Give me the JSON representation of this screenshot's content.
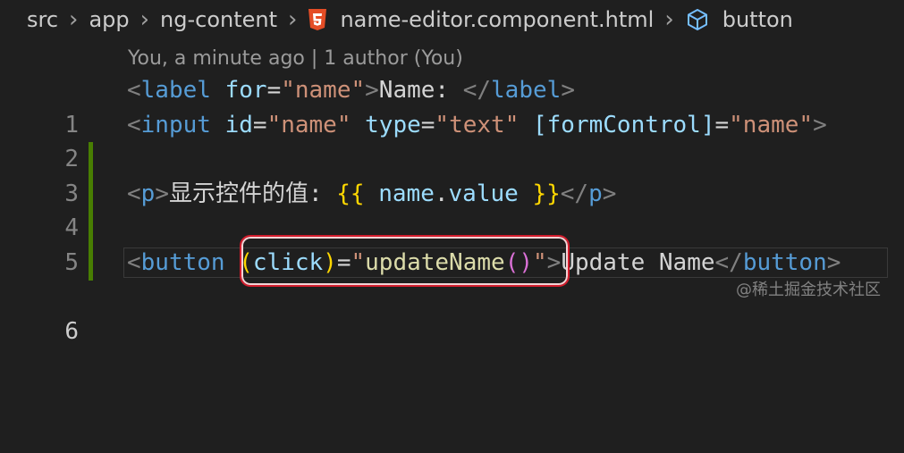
{
  "breadcrumb": {
    "items": [
      "src",
      "app",
      "ng-content",
      "name-editor.component.html",
      "button"
    ]
  },
  "blame": {
    "text": "You, a minute ago | 1 author (You)"
  },
  "lines": [
    {
      "number": "1"
    },
    {
      "number": "2"
    },
    {
      "number": "3"
    },
    {
      "number": "4"
    },
    {
      "number": "5"
    },
    {
      "number": "6"
    }
  ],
  "code": {
    "l1": {
      "lt": "<",
      "tag": "label",
      "attr": "for",
      "eq": "=",
      "val": "\"name\"",
      "gt": ">",
      "text": "Name: ",
      "close_lt": "</",
      "close_tag": "label",
      "close_gt": ">"
    },
    "l2": {
      "lt": "<",
      "tag": "input",
      "attr1": "id",
      "eq1": "=",
      "val1": "\"name\"",
      "attr2": "type",
      "eq2": "=",
      "val2": "\"text\"",
      "attr3": "[formControl]",
      "eq3": "=",
      "val3": "\"name\"",
      "gt": ">"
    },
    "l4": {
      "lt": "<",
      "tag": "p",
      "gt": ">",
      "text": "显示控件的值: ",
      "open": "{{",
      "expr_obj": "name",
      "expr_dot": ".",
      "expr_prop": "value",
      "close": "}}",
      "close_lt": "</",
      "close_tag": "p",
      "close_gt": ">"
    },
    "l6": {
      "lt": "<",
      "tag": "button",
      "attr_open": "(",
      "attr": "click",
      "attr_close": ")",
      "eq": "=",
      "q1": "\"",
      "func": "updateName",
      "paren": "()",
      "q2": "\"",
      "gt": ">",
      "text": "Update Name",
      "close_lt": "</",
      "close_tag": "button",
      "close_gt": ">"
    }
  },
  "colors": {
    "background": "#1f1f1f",
    "gutter_modified": "#487e02",
    "highlight_border": "#d31c2c"
  },
  "watermark": "@稀土掘金技术社区"
}
